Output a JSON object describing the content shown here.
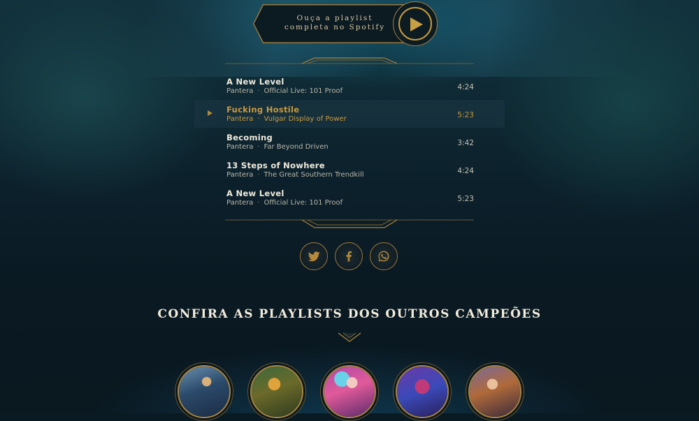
{
  "spotify_cta": {
    "line1": "Ouça a playlist",
    "line2": "completa no Spotify"
  },
  "tracks": [
    {
      "title": "A New Level",
      "artist": "Pantera",
      "album": "Official Live: 101 Proof",
      "duration": "4:24",
      "active": false
    },
    {
      "title": "Fucking Hostile",
      "artist": "Pantera",
      "album": "Vulgar Display of Power",
      "duration": "5:23",
      "active": true
    },
    {
      "title": "Becoming",
      "artist": "Pantera",
      "album": "Far Beyond Driven",
      "duration": "3:42",
      "active": false
    },
    {
      "title": "13 Steps of Nowhere",
      "artist": "Pantera",
      "album": "The Great Southern Trendkill",
      "duration": "4:24",
      "active": false
    },
    {
      "title": "A New Level",
      "artist": "Pantera",
      "album": "Official Live: 101 Proof",
      "duration": "5:23",
      "active": false
    }
  ],
  "separator": "·",
  "social": [
    {
      "name": "twitter",
      "icon": "twitter-icon"
    },
    {
      "name": "facebook",
      "icon": "facebook-icon"
    },
    {
      "name": "whatsapp",
      "icon": "whatsapp-icon"
    }
  ],
  "other_playlists": {
    "heading": "CONFIRA AS PLAYLISTS DOS OUTROS CAMPEÕES",
    "champion_count_visible": 5
  },
  "colors": {
    "gold": "#c89a3c",
    "gold_border": "#9b7a3a",
    "text_light": "#f0ebdc",
    "background": "#0a1a23"
  }
}
